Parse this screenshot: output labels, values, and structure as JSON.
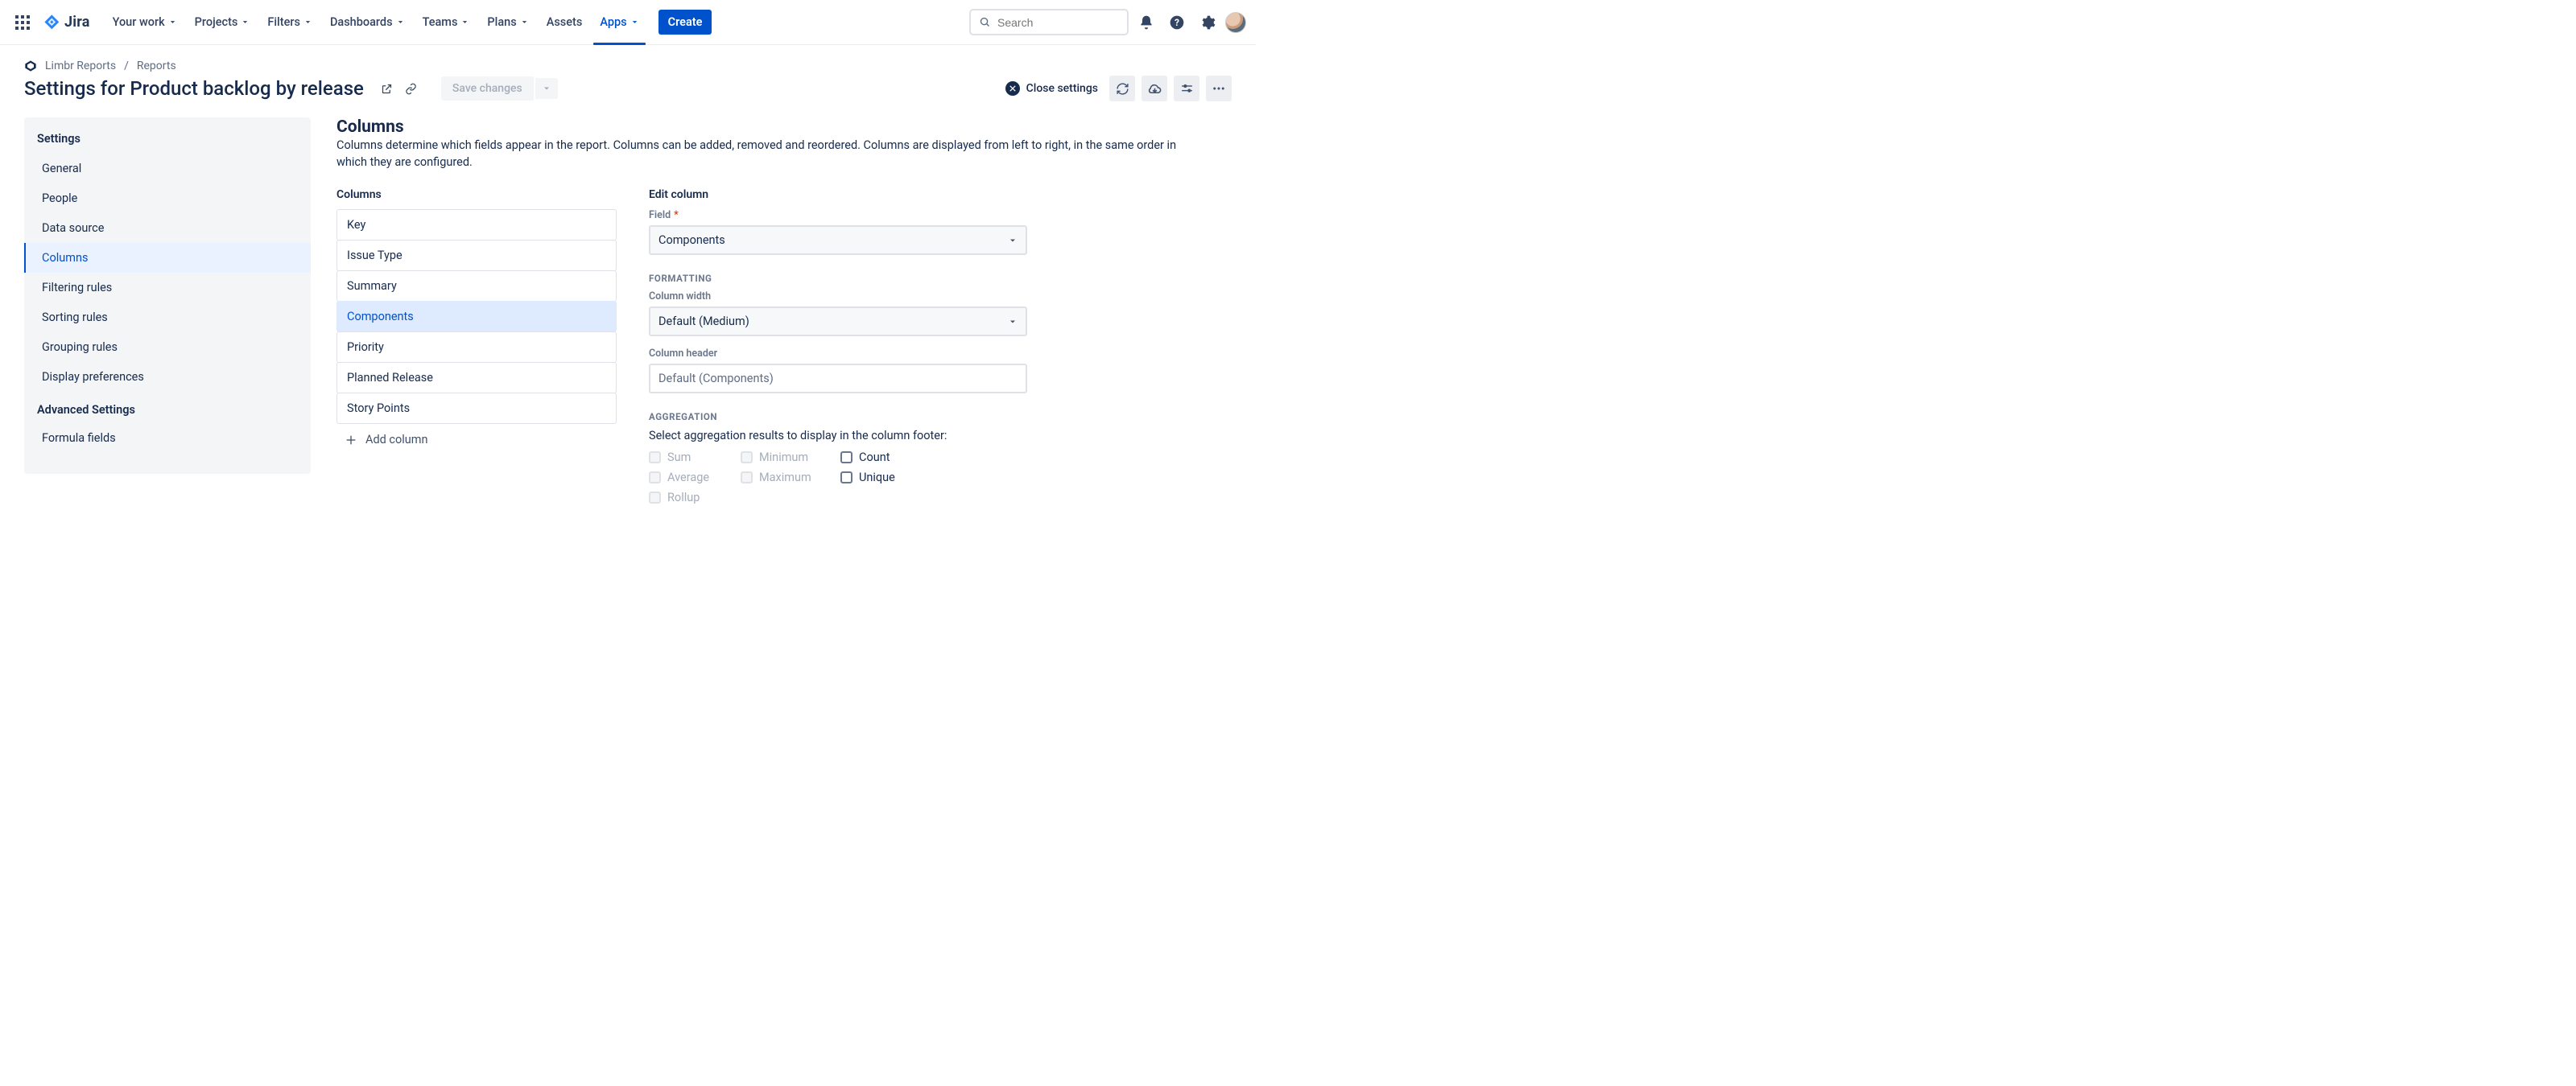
{
  "nav": {
    "product": "Jira",
    "items": [
      {
        "label": "Your work",
        "dropdown": true
      },
      {
        "label": "Projects",
        "dropdown": true
      },
      {
        "label": "Filters",
        "dropdown": true
      },
      {
        "label": "Dashboards",
        "dropdown": true
      },
      {
        "label": "Teams",
        "dropdown": true
      },
      {
        "label": "Plans",
        "dropdown": true
      },
      {
        "label": "Assets",
        "dropdown": false
      },
      {
        "label": "Apps",
        "dropdown": true,
        "active": true
      }
    ],
    "create": "Create",
    "search_placeholder": "Search"
  },
  "breadcrumb": {
    "project": "Limbr Reports",
    "section": "Reports"
  },
  "header": {
    "title_prefix": "Settings for",
    "title_name": "Product backlog by release",
    "save": "Save changes",
    "close": "Close settings"
  },
  "sidebar": {
    "heading": "Settings",
    "items": [
      "General",
      "People",
      "Data source",
      "Columns",
      "Filtering rules",
      "Sorting rules",
      "Grouping rules",
      "Display preferences"
    ],
    "selected": "Columns",
    "advanced_heading": "Advanced Settings",
    "advanced_items": [
      "Formula fields"
    ]
  },
  "columns_panel": {
    "heading": "Columns",
    "description": "Columns determine which fields appear in the report. Columns can be added, removed and reordered. Columns are displayed from left to right, in the same order in which they are configured.",
    "list_heading": "Columns",
    "items": [
      "Key",
      "Issue Type",
      "Summary",
      "Components",
      "Priority",
      "Planned Release",
      "Story Points"
    ],
    "selected": "Components",
    "add": "Add column"
  },
  "edit_panel": {
    "heading": "Edit column",
    "field_label": "Field",
    "field_value": "Components",
    "formatting_label": "FORMATTING",
    "width_label": "Column width",
    "width_value": "Default (Medium)",
    "header_label": "Column header",
    "header_placeholder": "Default (Components)",
    "aggregation_label": "AGGREGATION",
    "aggregation_lead": "Select aggregation results to display in the column footer:",
    "aggs": [
      {
        "label": "Sum",
        "enabled": false
      },
      {
        "label": "Minimum",
        "enabled": false
      },
      {
        "label": "Count",
        "enabled": true
      },
      {
        "label": "Average",
        "enabled": false
      },
      {
        "label": "Maximum",
        "enabled": false
      },
      {
        "label": "Unique",
        "enabled": true
      },
      {
        "label": "Rollup",
        "enabled": false
      }
    ]
  }
}
